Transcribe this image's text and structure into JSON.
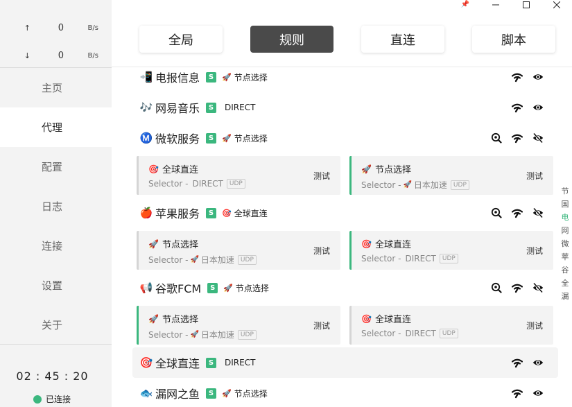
{
  "window": {
    "pin": "📌",
    "minimize": "—",
    "maximize": "☐",
    "close": "✕"
  },
  "speed": {
    "up_arrow": "↑",
    "up_value": "0",
    "up_unit": "B/s",
    "down_arrow": "↓",
    "down_value": "0",
    "down_unit": "B/s"
  },
  "nav": [
    "主页",
    "代理",
    "配置",
    "日志",
    "连接",
    "设置",
    "关于"
  ],
  "timer": "02 : 45 : 20",
  "connection_status": "已连接",
  "tabs": [
    "全局",
    "规则",
    "直连",
    "脚本"
  ],
  "badge": "S",
  "test_label": "测试",
  "udp_label": "UDP",
  "groups": [
    {
      "emoji": "📲",
      "name": "电报信息",
      "sel_emoji": "🚀",
      "selected": "节点选择"
    },
    {
      "emoji": "🎶",
      "name": "网易音乐",
      "sel_emoji": "",
      "selected": "DIRECT"
    },
    {
      "emoji": "Ⓜ️",
      "name": "微软服务",
      "sel_emoji": "🚀",
      "selected": "节点选择"
    },
    {
      "emoji": "🍎",
      "name": "苹果服务",
      "sel_emoji": "🎯",
      "selected": "全球直连"
    },
    {
      "emoji": "📢",
      "name": "谷歌FCM",
      "sel_emoji": "🚀",
      "selected": "节点选择"
    },
    {
      "emoji": "🎯",
      "name": "全球直连",
      "sel_emoji": "",
      "selected": "DIRECT"
    },
    {
      "emoji": "🐟",
      "name": "漏网之鱼",
      "sel_emoji": "🚀",
      "selected": "节点选择"
    }
  ],
  "cards": [
    {
      "emoji": "🎯",
      "title": "全球直连",
      "sub_prefix": "Selector - ",
      "sub_emoji": "",
      "sub": "DIRECT"
    },
    {
      "emoji": "🚀",
      "title": "节点选择",
      "sub_prefix": "Selector - ",
      "sub_emoji": "🚀",
      "sub": "日本加速"
    },
    {
      "emoji": "🚀",
      "title": "节点选择",
      "sub_prefix": "Selector - ",
      "sub_emoji": "🚀",
      "sub": "日本加速"
    },
    {
      "emoji": "🎯",
      "title": "全球直连",
      "sub_prefix": "Selector - ",
      "sub_emoji": "",
      "sub": "DIRECT"
    },
    {
      "emoji": "🚀",
      "title": "节点选择",
      "sub_prefix": "Selector - ",
      "sub_emoji": "🚀",
      "sub": "日本加速"
    },
    {
      "emoji": "🎯",
      "title": "全球直连",
      "sub_prefix": "Selector - ",
      "sub_emoji": "",
      "sub": "DIRECT"
    }
  ],
  "index": [
    "节",
    "国",
    "电",
    "网",
    "微",
    "苹",
    "谷",
    "全",
    "漏"
  ]
}
